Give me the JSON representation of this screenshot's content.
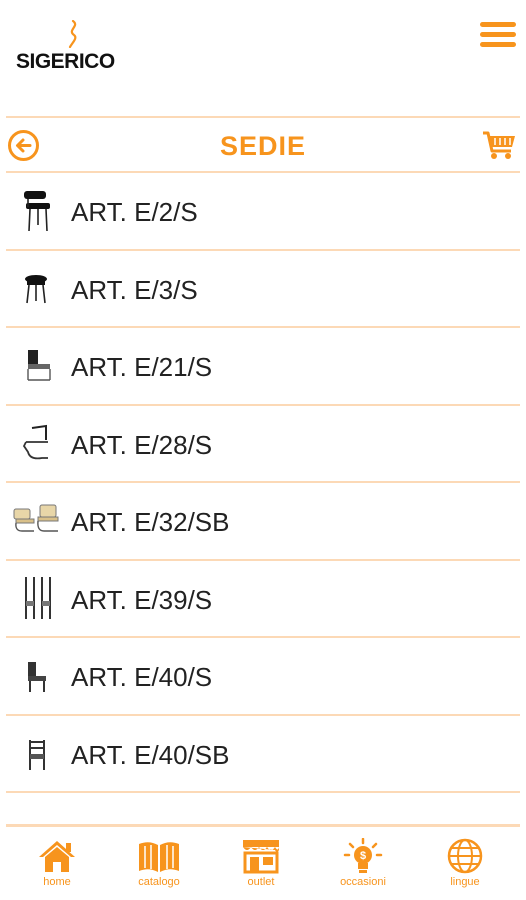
{
  "header": {
    "logo_text": "SIGERICO"
  },
  "titlebar": {
    "title": "SEDIE"
  },
  "items": [
    {
      "label": "ART. E/2/S"
    },
    {
      "label": "ART. E/3/S"
    },
    {
      "label": "ART. E/21/S"
    },
    {
      "label": "ART. E/28/S"
    },
    {
      "label": "ART. E/32/SB"
    },
    {
      "label": "ART. E/39/S"
    },
    {
      "label": "ART. E/40/S"
    },
    {
      "label": "ART. E/40/SB"
    }
  ],
  "nav": [
    {
      "label": "home",
      "icon": "home-icon"
    },
    {
      "label": "catalogo",
      "icon": "catalog-book-icon"
    },
    {
      "label": "outlet",
      "icon": "store-icon"
    },
    {
      "label": "occasioni",
      "icon": "lightbulb-dollar-icon"
    },
    {
      "label": "lingue",
      "icon": "globe-icon"
    }
  ],
  "colors": {
    "accent": "#f7941d",
    "divider": "#fcd9b6",
    "text": "#222222"
  }
}
